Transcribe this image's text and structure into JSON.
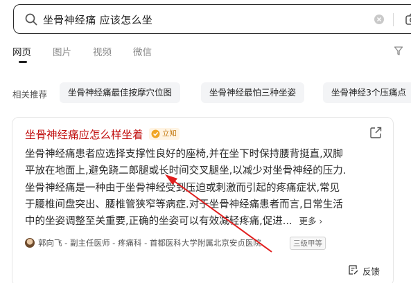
{
  "search": {
    "query": "坐骨神经痛 应该怎么坐",
    "icon": "search-icon",
    "clear_icon": "clear-icon",
    "camera_icon": "camera-icon"
  },
  "tabs": [
    {
      "label": "网页",
      "active": true
    },
    {
      "label": "图片",
      "active": false
    },
    {
      "label": "视频",
      "active": false
    },
    {
      "label": "微信",
      "active": false
    }
  ],
  "filter": {
    "icon": "filter-icon",
    "label": "Y"
  },
  "related": {
    "label": "相关推荐",
    "chips": [
      "坐骨神经痛最佳按摩穴位图",
      "坐骨神经最怕三种坐姿",
      "坐骨神经3个压痛点"
    ]
  },
  "result": {
    "title": "坐骨神经痛应怎么样坐着",
    "badge": "立知",
    "lines": [
      "坐骨神经痛患者应选择支撑性良好的座椅,并在坐下时保持腰背挺直,双脚",
      "平放在地面上,避免跷二郎腿或长时间交叉腿坐,以减少对坐骨神经的压力.",
      "坐骨神经痛是一种由于坐骨神经受到压迫或刺激而引起的疼痛症状,常见",
      "于腰椎间盘突出、腰椎管狭窄等病症.对于坐骨神经痛患者而言,日常生活",
      "中的坐姿调整至关重要,正确的坐姿可以有效减轻疼痛,促进..."
    ],
    "more": "更多",
    "source": "郭向飞 - 副主任医师 - 疼痛科 - 首都医科大学附属北京安贞医院",
    "grade": "三级甲等",
    "feedback": "反馈"
  },
  "colors": {
    "title_red": "#c00d0d",
    "arrow_red": "#e11d1d",
    "badge_bg": "#fff4e3",
    "chip_bg": "#f3f4f6"
  }
}
